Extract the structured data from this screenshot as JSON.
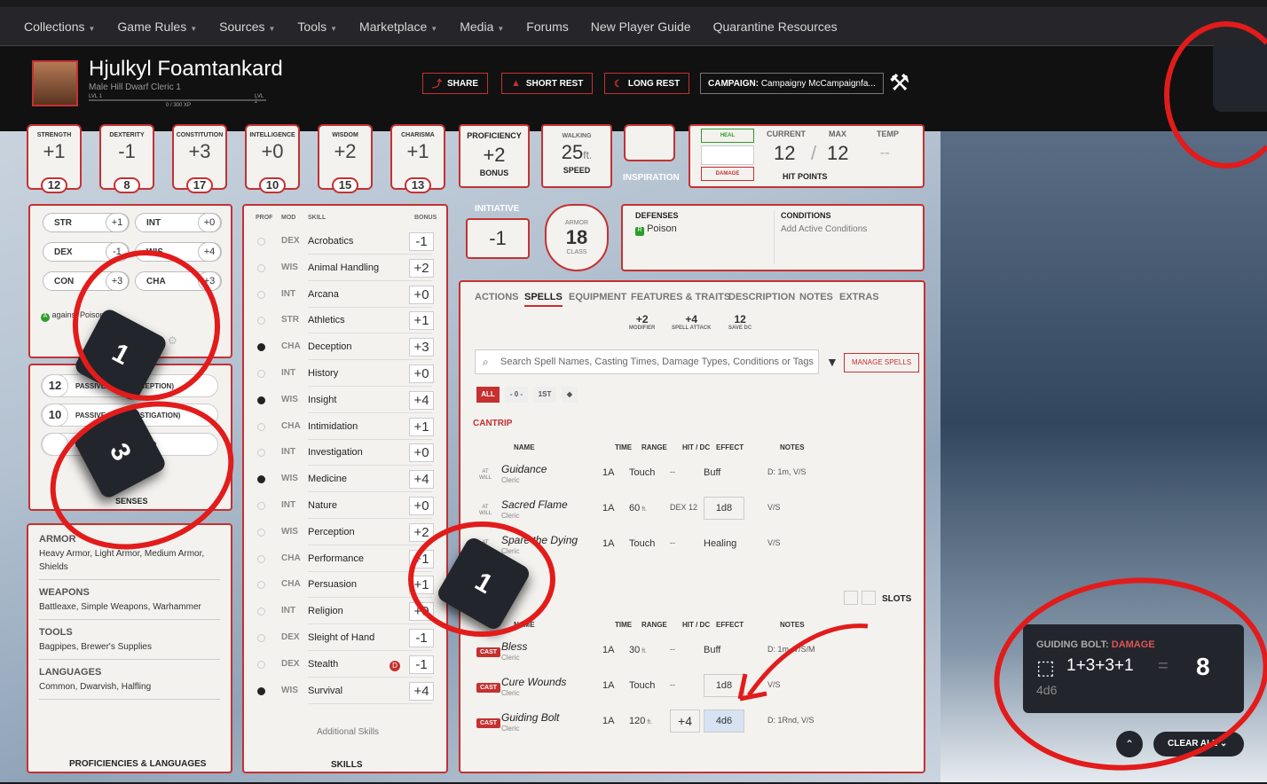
{
  "nav": [
    "Collections",
    "Game Rules",
    "Sources",
    "Tools",
    "Marketplace",
    "Media",
    "Forums",
    "New Player Guide",
    "Quarantine Resources"
  ],
  "nav_has_caret": [
    true,
    true,
    true,
    true,
    true,
    true,
    false,
    false,
    false
  ],
  "character": {
    "name": "Hjulkyl Foamtankard",
    "subtitle": "Male  Hill Dwarf  Cleric 1",
    "lvl1": "LVL 1",
    "lvl2": "LVL 2",
    "xp": "0 / 300 XP"
  },
  "header_buttons": {
    "share": "SHARE",
    "short_rest": "SHORT REST",
    "long_rest": "LONG REST",
    "campaign_label": "CAMPAIGN:",
    "campaign_name": "Campaigny McCampaignfa..."
  },
  "abilities": [
    {
      "label": "STRENGTH",
      "mod": "+1",
      "score": "12"
    },
    {
      "label": "DEXTERITY",
      "mod": "-1",
      "score": "8"
    },
    {
      "label": "CONSTITUTION",
      "mod": "+3",
      "score": "17"
    },
    {
      "label": "INTELLIGENCE",
      "mod": "+0",
      "score": "10"
    },
    {
      "label": "WISDOM",
      "mod": "+2",
      "score": "15"
    },
    {
      "label": "CHARISMA",
      "mod": "+1",
      "score": "13"
    }
  ],
  "proficiency": {
    "label": "PROFICIENCY",
    "value": "+2",
    "sub": "BONUS"
  },
  "speed": {
    "label": "WALKING",
    "value": "25",
    "unit": "ft.",
    "sub": "SPEED"
  },
  "inspiration": "INSPIRATION",
  "hp": {
    "heal": "HEAL",
    "damage": "DAMAGE",
    "current_label": "CURRENT",
    "max_label": "MAX",
    "temp_label": "TEMP",
    "current": "12",
    "max": "12",
    "temp": "--",
    "sep": "/",
    "title": "HIT POINTS"
  },
  "initiative": {
    "label": "INITIATIVE",
    "value": "-1"
  },
  "armor": {
    "top": "ARMOR",
    "value": "18",
    "bottom": "CLASS"
  },
  "defenses": {
    "label": "DEFENSES",
    "item": "Poison",
    "badge": "R"
  },
  "conditions": {
    "label": "CONDITIONS",
    "add": "Add Active Conditions"
  },
  "saves": [
    {
      "name": "STR",
      "val": "+1"
    },
    {
      "name": "INT",
      "val": "+0"
    },
    {
      "name": "DEX",
      "val": "-1"
    },
    {
      "name": "WIS",
      "val": "+4"
    },
    {
      "name": "CON",
      "val": "+3"
    },
    {
      "name": "CHA",
      "val": "+3"
    }
  ],
  "save_note": {
    "badge": "A",
    "text": "against Poison"
  },
  "passives": [
    {
      "val": "12",
      "label": "PASSIVE WIS (PERCEPTION)"
    },
    {
      "val": "10",
      "label": "PASSIVE INT (INVESTIGATION)"
    },
    {
      "val": "",
      "label": "PASSIVE WIS (INSIGHT)"
    }
  ],
  "senses_title": "SENSES",
  "profs": [
    {
      "h": "ARMOR",
      "t": "Heavy Armor, Light Armor, Medium Armor, Shields"
    },
    {
      "h": "WEAPONS",
      "t": "Battleaxe, Simple Weapons, Warhammer"
    },
    {
      "h": "TOOLS",
      "t": "Bagpipes, Brewer's Supplies"
    },
    {
      "h": "LANGUAGES",
      "t": "Common, Dwarvish, Halfling"
    }
  ],
  "profs_title": "PROFICIENCIES & LANGUAGES",
  "skills_header": {
    "prof": "PROF",
    "mod": "MOD",
    "skill": "SKILL",
    "bonus": "BONUS"
  },
  "skills": [
    {
      "p": false,
      "m": "DEX",
      "n": "Acrobatics",
      "b": "-1"
    },
    {
      "p": false,
      "m": "WIS",
      "n": "Animal Handling",
      "b": "+2"
    },
    {
      "p": false,
      "m": "INT",
      "n": "Arcana",
      "b": "+0"
    },
    {
      "p": false,
      "m": "STR",
      "n": "Athletics",
      "b": "+1"
    },
    {
      "p": true,
      "m": "CHA",
      "n": "Deception",
      "b": "+3"
    },
    {
      "p": false,
      "m": "INT",
      "n": "History",
      "b": "+0"
    },
    {
      "p": true,
      "m": "WIS",
      "n": "Insight",
      "b": "+4"
    },
    {
      "p": false,
      "m": "CHA",
      "n": "Intimidation",
      "b": "+1"
    },
    {
      "p": false,
      "m": "INT",
      "n": "Investigation",
      "b": "+0"
    },
    {
      "p": true,
      "m": "WIS",
      "n": "Medicine",
      "b": "+4"
    },
    {
      "p": false,
      "m": "INT",
      "n": "Nature",
      "b": "+0"
    },
    {
      "p": false,
      "m": "WIS",
      "n": "Perception",
      "b": "+2"
    },
    {
      "p": false,
      "m": "CHA",
      "n": "Performance",
      "b": "+1"
    },
    {
      "p": false,
      "m": "CHA",
      "n": "Persuasion",
      "b": "+1"
    },
    {
      "p": false,
      "m": "INT",
      "n": "Religion",
      "b": "+0"
    },
    {
      "p": false,
      "m": "DEX",
      "n": "Sleight of Hand",
      "b": "-1"
    },
    {
      "p": false,
      "m": "DEX",
      "n": "Stealth",
      "b": "-1",
      "disadv": "D"
    },
    {
      "p": true,
      "m": "WIS",
      "n": "Survival",
      "b": "+4"
    }
  ],
  "additional_skills": "Additional Skills",
  "skills_title": "SKILLS",
  "tabs": [
    "ACTIONS",
    "SPELLS",
    "EQUIPMENT",
    "FEATURES & TRAITS",
    "DESCRIPTION",
    "NOTES",
    "EXTRAS"
  ],
  "active_tab": 1,
  "spell_stats": [
    {
      "v": "+2",
      "l": "MODIFIER"
    },
    {
      "v": "+4",
      "l": "SPELL ATTACK"
    },
    {
      "v": "12",
      "l": "SAVE DC"
    }
  ],
  "spell_search": "Search Spell Names, Casting Times, Damage Types, Conditions or Tags",
  "manage_spells": "MANAGE SPELLS",
  "filters": [
    "ALL",
    "- 0 -",
    "1ST",
    "◆"
  ],
  "cantrip_label": "CANTRIP",
  "spell_cols": {
    "name": "NAME",
    "time": "TIME",
    "range": "RANGE",
    "hit": "HIT / DC",
    "effect": "EFFECT",
    "notes": "NOTES"
  },
  "cantrips": [
    {
      "name": "Guidance",
      "src": "Cleric",
      "time": "1A",
      "range": "Touch",
      "hit": "--",
      "effect": "Buff",
      "notes": "D: 1m, V/S"
    },
    {
      "name": "Sacred Flame",
      "src": "Cleric",
      "time": "1A",
      "range": "60",
      "range_unit": "ft.",
      "hit": "DEX 12",
      "effect": "1d8",
      "notes": "V/S"
    },
    {
      "name": "Spare the Dying",
      "src": "Cleric",
      "time": "1A",
      "range": "Touch",
      "hit": "--",
      "effect": "Healing",
      "notes": "V/S"
    }
  ],
  "at_will": "AT WILL",
  "slots_label": "SLOTS",
  "level1": [
    {
      "name": "Bless",
      "src": "Cleric",
      "time": "1A",
      "range": "30",
      "range_unit": "ft.",
      "hit": "--",
      "effect": "Buff",
      "notes": "D: 1m, V/S/M"
    },
    {
      "name": "Cure Wounds",
      "src": "Cleric",
      "time": "1A",
      "range": "Touch",
      "hit": "--",
      "effect": "1d8",
      "notes": "V/S"
    },
    {
      "name": "Guiding Bolt",
      "src": "Cleric",
      "time": "1A",
      "range": "120",
      "range_unit": "ft.",
      "hit": "+4",
      "effect": "4d6",
      "notes": "D: 1Rnd, V/S"
    }
  ],
  "cast": "CAST",
  "roll": {
    "title": "GUIDING BOLT:",
    "type": "DAMAGE",
    "expr": "1+3+3+1",
    "dice": "4d6",
    "eq": "=",
    "total": "8"
  },
  "clear_all": "CLEAR ALL",
  "dice": [
    "1",
    "3",
    "1"
  ],
  "colors": {
    "accent": "#c53131",
    "annotation": "#e21b1b"
  }
}
